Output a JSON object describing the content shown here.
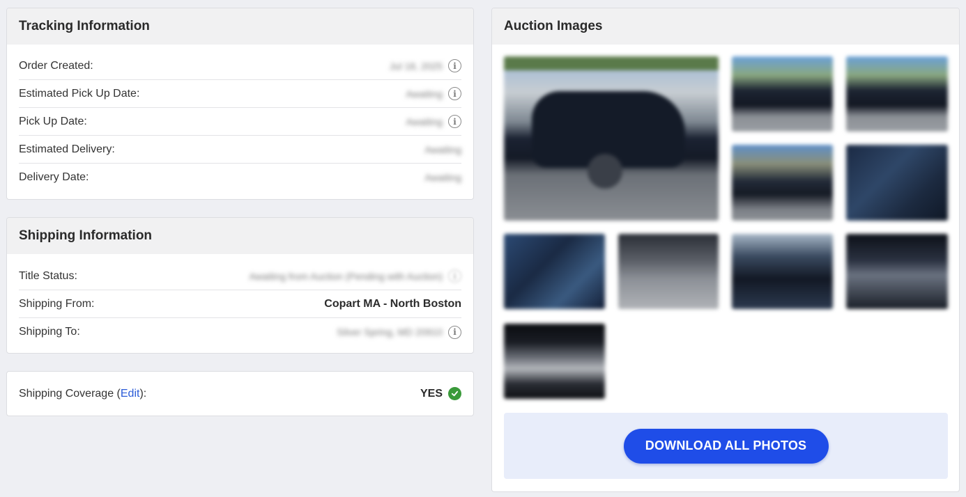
{
  "tracking": {
    "title": "Tracking Information",
    "rows": [
      {
        "label": "Order Created:",
        "value": "Jul 18, 2025"
      },
      {
        "label": "Estimated Pick Up Date:",
        "value": "Awaiting"
      },
      {
        "label": "Pick Up Date:",
        "value": "Awaiting"
      },
      {
        "label": "Estimated Delivery:",
        "value": "Awaiting"
      },
      {
        "label": "Delivery Date:",
        "value": "Awaiting"
      }
    ]
  },
  "shipping": {
    "title": "Shipping Information",
    "rows": [
      {
        "label": "Title Status:",
        "value": "Awaiting from Auction (Pending with Auction)"
      },
      {
        "label": "Shipping From:",
        "value": "Copart MA - North Boston"
      },
      {
        "label": "Shipping To:",
        "value": "Silver Spring, MD 20910"
      }
    ]
  },
  "coverage": {
    "label_prefix": "Shipping Coverage (",
    "edit_label": "Edit",
    "label_suffix": "):",
    "value": "YES"
  },
  "auction": {
    "title": "Auction Images",
    "download_label": "DOWNLOAD ALL PHOTOS"
  },
  "colors": {
    "accent": "#1f4de8",
    "link": "#2a5bd7",
    "success": "#3a9a3a",
    "page_bg": "#eeeff3"
  }
}
